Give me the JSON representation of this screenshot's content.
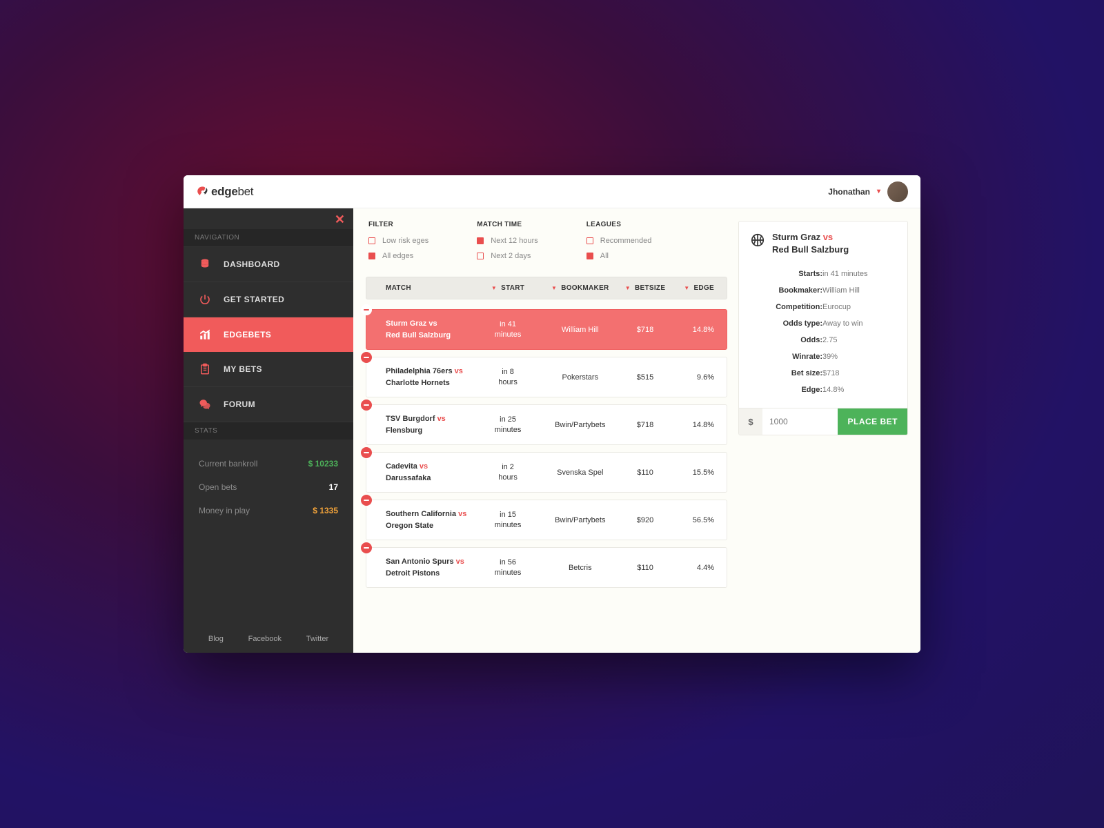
{
  "brand": {
    "word1": "edge",
    "word2": "bet"
  },
  "user": {
    "name": "Jhonathan"
  },
  "sidebar": {
    "navigation_label": "NAVIGATION",
    "items": [
      {
        "label": "DASHBOARD"
      },
      {
        "label": "GET STARTED"
      },
      {
        "label": "EDGEBETS"
      },
      {
        "label": "MY BETS"
      },
      {
        "label": "FORUM"
      }
    ],
    "stats_label": "STATS",
    "stats": {
      "bankroll_label": "Current bankroll",
      "bankroll_value": "$ 10233",
      "openbets_label": "Open bets",
      "openbets_value": "17",
      "moneyinplay_label": "Money in play",
      "moneyinplay_value": "$ 1335"
    },
    "footer": {
      "blog": "Blog",
      "facebook": "Facebook",
      "twitter": "Twitter"
    }
  },
  "filters": {
    "filter": {
      "head": "FILTER",
      "opt1": "Low risk eges",
      "opt2": "All edges"
    },
    "matchtime": {
      "head": "MATCH TIME",
      "opt1": "Next 12 hours",
      "opt2": "Next 2 days"
    },
    "leagues": {
      "head": "LEAGUES",
      "opt1": "Recommended",
      "opt2": "All"
    }
  },
  "table": {
    "headers": {
      "match": "MATCH",
      "start": "START",
      "bookmaker": "BOOKMAKER",
      "betsize": "BETSIZE",
      "edge": "EDGE"
    },
    "rows": [
      {
        "team1": "Sturm Graz",
        "team2": "Red Bull Salzburg",
        "start": "in 41 minutes",
        "bookmaker": "William Hill",
        "betsize": "$718",
        "edge": "14.8%",
        "active": true
      },
      {
        "team1": "Philadelphia 76ers",
        "team2": "Charlotte Hornets",
        "start": "in 8 hours",
        "bookmaker": "Pokerstars",
        "betsize": "$515",
        "edge": "9.6%"
      },
      {
        "team1": "TSV Burgdorf",
        "team2": "Flensburg",
        "start": "in 25 minutes",
        "bookmaker": "Bwin/Partybets",
        "betsize": "$718",
        "edge": "14.8%"
      },
      {
        "team1": "Cadevita",
        "team2": "Darussafaka",
        "start": "in 2 hours",
        "bookmaker": "Svenska Spel",
        "betsize": "$110",
        "edge": "15.5%"
      },
      {
        "team1": "Southern California",
        "team2": "Oregon State",
        "start": "in 15 minutes",
        "bookmaker": "Bwin/Partybets",
        "betsize": "$920",
        "edge": "56.5%"
      },
      {
        "team1": "San Antonio Spurs",
        "team2": "Detroit Pistons",
        "start": "in 56 minutes",
        "bookmaker": "Betcris",
        "betsize": "$110",
        "edge": "4.4%"
      }
    ]
  },
  "panel": {
    "title_team1": "Sturm Graz",
    "title_vs": "vs",
    "title_team2": "Red Bull Salzburg",
    "rows": {
      "starts": {
        "k": "Starts:",
        "v": "in 41 minutes"
      },
      "bookmaker": {
        "k": "Bookmaker:",
        "v": "William Hill"
      },
      "competition": {
        "k": "Competition:",
        "v": "Eurocup"
      },
      "oddstype": {
        "k": "Odds type:",
        "v": "Away to win"
      },
      "odds": {
        "k": "Odds:",
        "v": "2.75"
      },
      "winrate": {
        "k": "Winrate:",
        "v": "39%"
      },
      "betsize": {
        "k": "Bet size:",
        "v": "$718"
      },
      "edge": {
        "k": "Edge:",
        "v": "14.8%"
      }
    },
    "currency": "$",
    "amount_placeholder": "1000",
    "place_label": "PLACE BET"
  }
}
